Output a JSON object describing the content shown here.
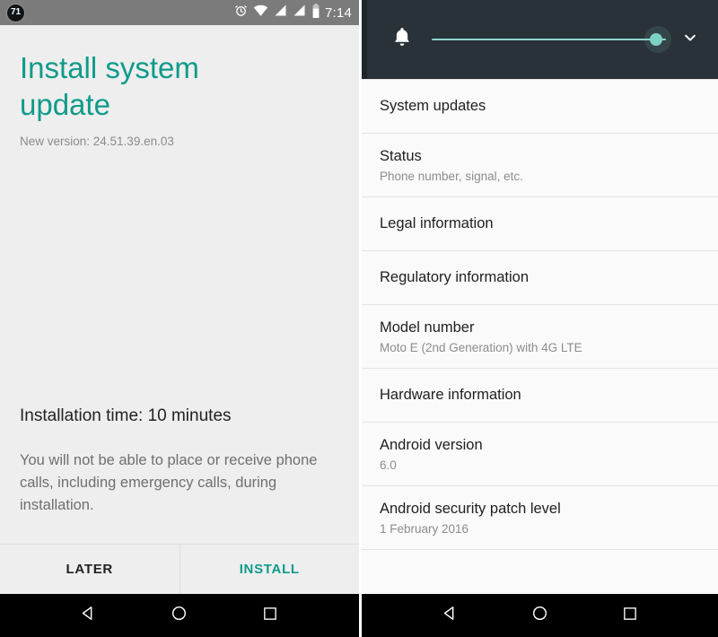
{
  "left_phone": {
    "statusbar": {
      "notification_badge": "71",
      "icons": [
        "alarm-icon",
        "wifi-icon",
        "signal-icon",
        "signal-icon",
        "battery-icon"
      ],
      "time": "7:14"
    },
    "dialog": {
      "title": "Install system update",
      "subtitle": "New version: 24.51.39.en.03",
      "install_time": "Installation time: 10 minutes",
      "warning": "You will not be able to place or receive phone calls, including emergency calls, during installation.",
      "later_label": "LATER",
      "install_label": "INSTALL",
      "title_color": "#0f9b8a",
      "accent_color": "#0f9b8a",
      "background_color": "#eeeeee"
    },
    "navbar": {
      "back": "back-triangle-icon",
      "home": "home-circle-icon",
      "recents": "recents-square-icon"
    }
  },
  "right_phone": {
    "volume_panel": {
      "icon": "notification-bell-icon",
      "slider_value": 100,
      "slider_min": 0,
      "slider_max": 100,
      "expand_icon": "chevron-down-icon",
      "background_color": "#283238",
      "accent_color": "#7bd3c6"
    },
    "settings_list": [
      {
        "title": "System updates",
        "subtitle": ""
      },
      {
        "title": "Status",
        "subtitle": "Phone number, signal, etc."
      },
      {
        "title": "Legal information",
        "subtitle": ""
      },
      {
        "title": "Regulatory information",
        "subtitle": ""
      },
      {
        "title": "Model number",
        "subtitle": "Moto E (2nd Generation) with 4G LTE"
      },
      {
        "title": "Hardware information",
        "subtitle": ""
      },
      {
        "title": "Android version",
        "subtitle": "6.0"
      },
      {
        "title": "Android security patch level",
        "subtitle": "1 February 2016"
      }
    ],
    "navbar": {
      "back": "back-triangle-icon",
      "home": "home-circle-icon",
      "recents": "recents-square-icon"
    }
  }
}
